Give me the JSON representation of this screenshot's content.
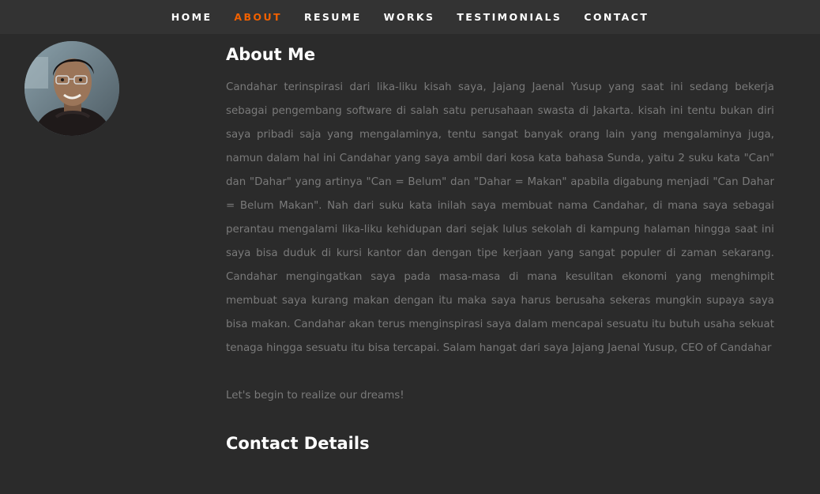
{
  "nav": {
    "items": [
      {
        "label": "HOME",
        "active": false
      },
      {
        "label": "ABOUT",
        "active": true
      },
      {
        "label": "RESUME",
        "active": false
      },
      {
        "label": "WORKS",
        "active": false
      },
      {
        "label": "TESTIMONIALS",
        "active": false
      },
      {
        "label": "CONTACT",
        "active": false
      }
    ]
  },
  "about": {
    "title": "About Me",
    "bio": "Candahar terinspirasi dari lika-liku kisah saya, Jajang Jaenal Yusup yang saat ini sedang bekerja sebagai pengembang software di salah satu perusahaan swasta di Jakarta. kisah ini tentu bukan diri saya pribadi saja yang mengalaminya, tentu sangat banyak orang lain yang mengalaminya juga, namun dalam hal ini Candahar yang saya ambil dari kosa kata bahasa Sunda, yaitu 2 suku kata \"Can\" dan \"Dahar\" yang artinya \"Can = Belum\" dan \"Dahar = Makan\" apabila digabung menjadi \"Can Dahar = Belum Makan\". Nah dari suku kata inilah saya membuat nama Candahar, di mana saya sebagai perantau mengalami lika-liku kehidupan dari sejak lulus sekolah di kampung halaman hingga saat ini saya bisa duduk di kursi kantor dan dengan tipe kerjaan yang sangat populer di zaman sekarang. Candahar mengingatkan saya pada masa-masa di mana kesulitan ekonomi yang menghimpit membuat saya kurang makan dengan itu maka saya harus berusaha sekeras mungkin supaya saya bisa makan. Candahar akan terus menginspirasi saya dalam mencapai sesuatu itu butuh usaha sekuat tenaga hingga sesuatu itu bisa tercapai. Salam hangat dari saya Jajang Jaenal Yusup, CEO of Candahar",
    "tagline": "Let's begin to realize our dreams!"
  },
  "contact": {
    "title": "Contact Details"
  },
  "colors": {
    "background": "#2b2b2b",
    "nav_background": "#333333",
    "nav_active": "#f06000",
    "heading": "#ffffff",
    "body_text": "#7a7a7a"
  }
}
